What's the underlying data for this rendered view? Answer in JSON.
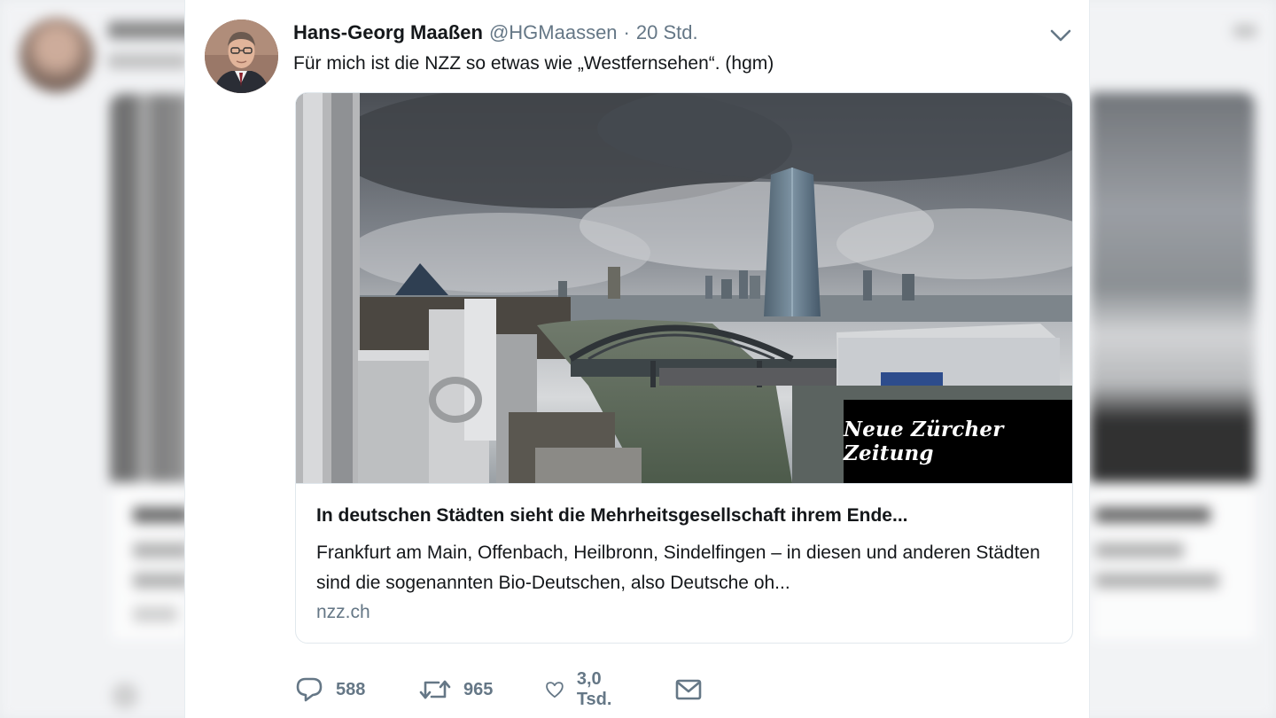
{
  "tweet": {
    "author_name": "Hans-Georg Maaßen",
    "handle": "@HGMaassen",
    "separator": "·",
    "time": "20 Std.",
    "text": "Für mich ist die NZZ so etwas wie „Westfernsehen“. (hgm)"
  },
  "card": {
    "image_overlay_text": "Neue Zürcher Zeitung",
    "title": "In deutschen Städten sieht die Mehrheitsgesellschaft ihrem Ende...",
    "description": "Frankfurt am Main, Offenbach, Heilbronn, Sindelfingen – in diesen und anderen Städten sind die sogenannten Bio-Deutschen, also Deutsche oh...",
    "domain": "nzz.ch"
  },
  "actions": {
    "reply_count": "588",
    "retweet_count": "965",
    "like_count": "3,0 Tsd."
  },
  "icons": {
    "reply": "reply-icon",
    "retweet": "retweet-icon",
    "like": "heart-icon",
    "message": "envelope-icon",
    "menu": "chevron-down-icon"
  },
  "colors": {
    "secondary_text": "#657786",
    "primary_text": "#14171a",
    "border": "#e1e8ed"
  }
}
